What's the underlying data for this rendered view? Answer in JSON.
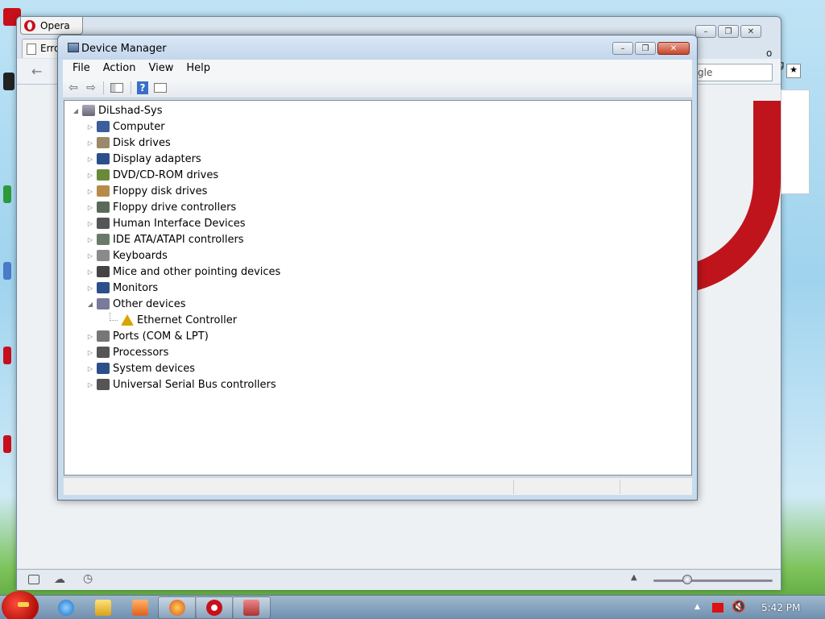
{
  "opera": {
    "title": "Opera",
    "tab_label": "Erro",
    "search_placeholder": "gle",
    "partial_text": "o pag"
  },
  "device_manager": {
    "title": "Device Manager",
    "menu": [
      "File",
      "Action",
      "View",
      "Help"
    ],
    "root": "DiLshad-Sys",
    "categories": [
      {
        "label": "Computer",
        "expanded": false,
        "color": "#3a5f9a"
      },
      {
        "label": "Disk drives",
        "expanded": false,
        "color": "#9a8a6a"
      },
      {
        "label": "Display adapters",
        "expanded": false,
        "color": "#2b4f8a"
      },
      {
        "label": "DVD/CD-ROM drives",
        "expanded": false,
        "color": "#6a8a3a"
      },
      {
        "label": "Floppy disk drives",
        "expanded": false,
        "color": "#b88a4a"
      },
      {
        "label": "Floppy drive controllers",
        "expanded": false,
        "color": "#5a6a5a"
      },
      {
        "label": "Human Interface Devices",
        "expanded": false,
        "color": "#555555"
      },
      {
        "label": "IDE ATA/ATAPI controllers",
        "expanded": false,
        "color": "#6a7a6a"
      },
      {
        "label": "Keyboards",
        "expanded": false,
        "color": "#8a8a8a"
      },
      {
        "label": "Mice and other pointing devices",
        "expanded": false,
        "color": "#444444"
      },
      {
        "label": "Monitors",
        "expanded": false,
        "color": "#2b4f8a"
      },
      {
        "label": "Other devices",
        "expanded": true,
        "color": "#7a7a9a",
        "children": [
          {
            "label": "Ethernet Controller",
            "warning": true,
            "color": "#d9a400"
          }
        ]
      },
      {
        "label": "Ports (COM & LPT)",
        "expanded": false,
        "color": "#777777"
      },
      {
        "label": "Processors",
        "expanded": false,
        "color": "#555555"
      },
      {
        "label": "System devices",
        "expanded": false,
        "color": "#2b4f8a"
      },
      {
        "label": "Universal Serial Bus controllers",
        "expanded": false,
        "color": "#555555"
      }
    ]
  },
  "taskbar": {
    "clock": "5:42 PM"
  }
}
